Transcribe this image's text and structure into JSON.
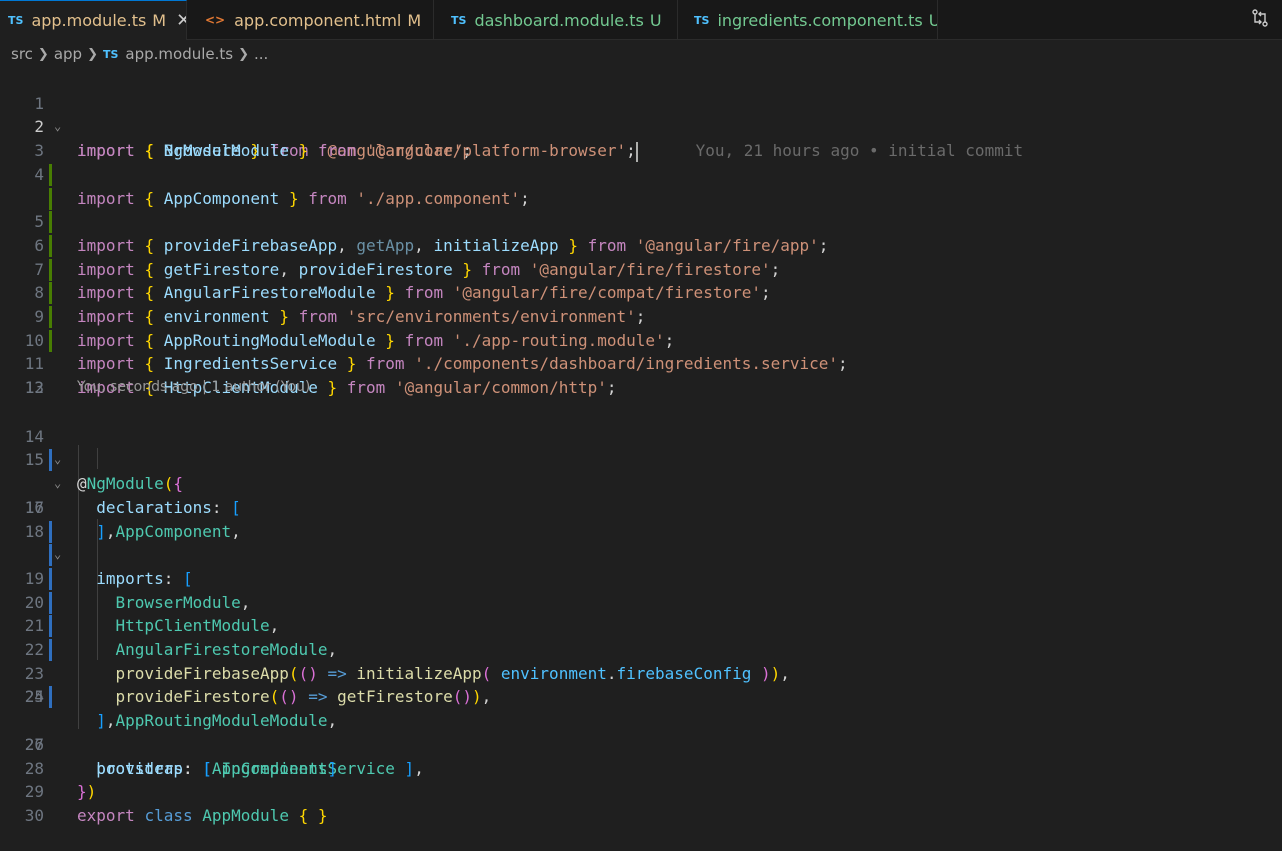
{
  "tabs": [
    {
      "icon": "TS",
      "icon_name": "typescript-icon",
      "label": "app.module.ts",
      "status": "M",
      "active": true
    },
    {
      "icon": "<>",
      "icon_name": "html-icon",
      "label": "app.component.html",
      "status": "M",
      "active": false
    },
    {
      "icon": "TS",
      "icon_name": "typescript-icon",
      "label": "dashboard.module.ts",
      "status": "U",
      "active": false
    },
    {
      "icon": "TS",
      "icon_name": "typescript-icon",
      "label": "ingredients.component.ts",
      "status": "U",
      "active": false
    }
  ],
  "tab_close_glyph": "✕",
  "breadcrumb": {
    "parts": [
      "src",
      "app"
    ],
    "file_icon": "TS",
    "file": "app.module.ts",
    "more": "..."
  },
  "editor": {
    "current_line": 2,
    "inline_blame": "You, 21 hours ago • initial commit",
    "codelens": "You, seconds ago | 1 author (You)",
    "lines": [
      {
        "n": "1",
        "text": "import { NgModule } from '@angular/core';"
      },
      {
        "n": "2",
        "text": "import { BrowserModule } from '@angular/platform-browser';"
      },
      {
        "n": "3",
        "text": ""
      },
      {
        "n": "4",
        "text": "import { AppComponent } from './app.component';"
      },
      {
        "n": "5",
        "text": "import { provideFirebaseApp, getApp, initializeApp } from '@angular/fire/app';"
      },
      {
        "n": "6",
        "text": "import { getFirestore, provideFirestore } from '@angular/fire/firestore';"
      },
      {
        "n": "7",
        "text": "import { AngularFirestoreModule } from '@angular/fire/compat/firestore';"
      },
      {
        "n": "8",
        "text": "import { environment } from 'src/environments/environment';"
      },
      {
        "n": "9",
        "text": "import { AppRoutingModuleModule } from './app-routing.module';"
      },
      {
        "n": "10",
        "text": "import { IngredientsService } from './components/dashboard/ingredients.service';"
      },
      {
        "n": "11",
        "text": "import { HttpClientModule } from '@angular/common/http';"
      },
      {
        "n": "12",
        "text": ""
      },
      {
        "n": "13",
        "text": ""
      },
      {
        "n": "14",
        "text": "@NgModule({"
      },
      {
        "n": "15",
        "text": "  declarations: ["
      },
      {
        "n": "16",
        "text": "    AppComponent,"
      },
      {
        "n": "17",
        "text": "  ],"
      },
      {
        "n": "18",
        "text": "  imports: ["
      },
      {
        "n": "19",
        "text": "    BrowserModule,"
      },
      {
        "n": "20",
        "text": "    HttpClientModule,"
      },
      {
        "n": "21",
        "text": "    AngularFirestoreModule,"
      },
      {
        "n": "22",
        "text": "    provideFirebaseApp(() => initializeApp( environment.firebaseConfig )),"
      },
      {
        "n": "23",
        "text": "    provideFirestore(() => getFirestore()),"
      },
      {
        "n": "24",
        "text": "    AppRoutingModuleModule,"
      },
      {
        "n": "25",
        "text": "  ],"
      },
      {
        "n": "26",
        "text": "  providers: [ IngredientsService ],"
      },
      {
        "n": "27",
        "text": "  bootstrap: [AppComponent]"
      },
      {
        "n": "28",
        "text": "})"
      },
      {
        "n": "29",
        "text": "export class AppModule { }"
      },
      {
        "n": "30",
        "text": ""
      }
    ]
  },
  "colors": {
    "background": "#1f1f1f",
    "keyword": "#569cd6",
    "control_keyword": "#c586c0",
    "variable": "#9cdcfe",
    "type": "#4ec9b0",
    "function": "#dcdcaa",
    "string": "#ce9178",
    "modified_gutter": "#2f6fbf",
    "added_gutter": "#487e02"
  }
}
